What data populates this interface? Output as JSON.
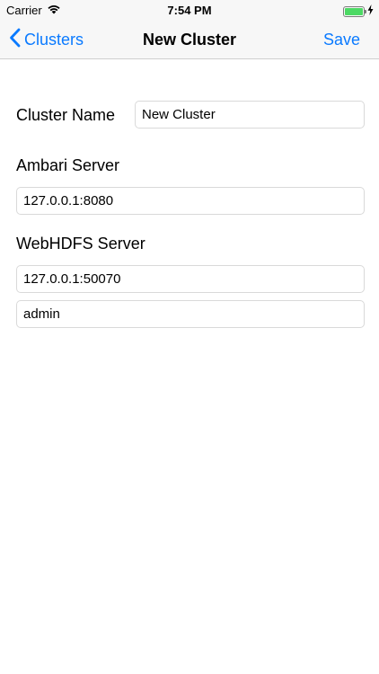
{
  "status_bar": {
    "carrier": "Carrier",
    "time": "7:54 PM",
    "battery_level": 1.0,
    "battery_color": "#4cd964"
  },
  "nav": {
    "back_label": "Clusters",
    "title": "New Cluster",
    "save_label": "Save",
    "accent_color": "#0a7aff"
  },
  "form": {
    "cluster_name_label": "Cluster Name",
    "cluster_name_value": "New Cluster",
    "ambari_label": "Ambari Server",
    "ambari_value": "127.0.0.1:8080",
    "webhdfs_label": "WebHDFS Server",
    "webhdfs_value": "127.0.0.1:50070",
    "user_value": "admin"
  }
}
